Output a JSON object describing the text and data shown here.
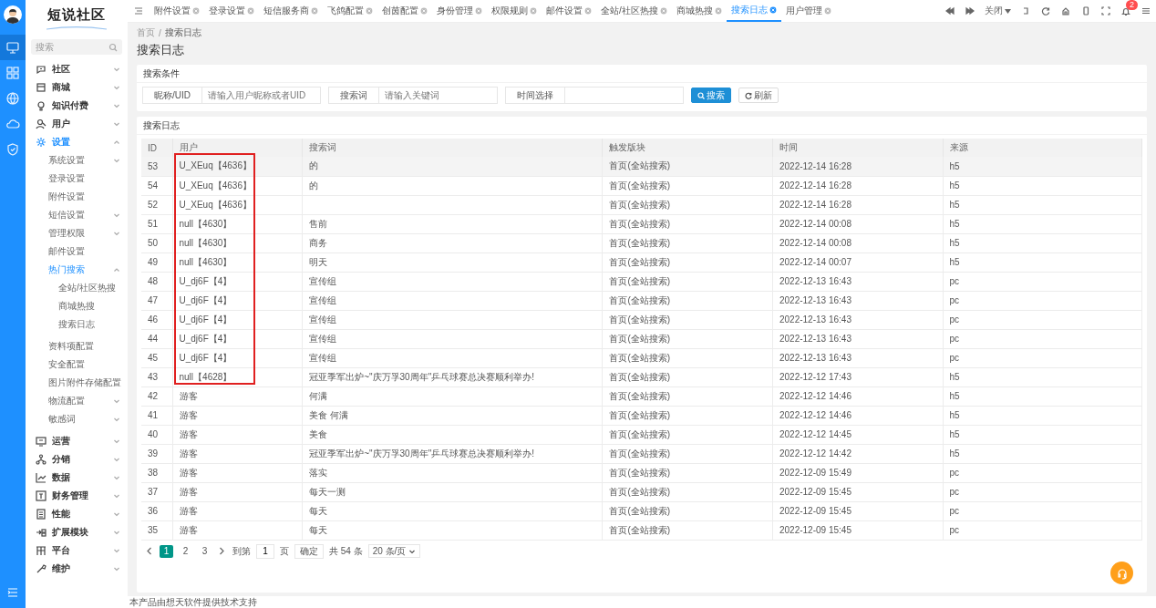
{
  "rail": [
    {
      "selected": true
    },
    {
      "selected": false
    },
    {
      "selected": false
    },
    {
      "selected": false
    },
    {
      "selected": false
    }
  ],
  "brand": {
    "name": "短说社区"
  },
  "sidebar": {
    "search": {
      "placeholder": "搜索"
    },
    "items": [
      {
        "label": "社区",
        "expanded": false
      },
      {
        "label": "商城",
        "expanded": false
      },
      {
        "label": "知识付费",
        "expanded": false
      },
      {
        "label": "用户",
        "expanded": false
      },
      {
        "label": "设置",
        "expanded": true,
        "children": [
          {
            "label": "系统设置",
            "expanded": false
          },
          {
            "label": "登录设置"
          },
          {
            "label": "附件设置"
          },
          {
            "label": "短信设置",
            "expanded": false
          },
          {
            "label": "管理权限",
            "expanded": false
          },
          {
            "label": "邮件设置"
          },
          {
            "label": "热门搜索",
            "expanded": true,
            "children": [
              {
                "label": "全站/社区热搜"
              },
              {
                "label": "商城热搜"
              },
              {
                "label": "搜索日志"
              }
            ]
          },
          {
            "label": "资料项配置"
          },
          {
            "label": "安全配置"
          },
          {
            "label": "图片附件存储配置"
          },
          {
            "label": "物流配置",
            "expanded": false
          },
          {
            "label": "敏感词",
            "expanded": false
          }
        ]
      },
      {
        "label": "运营",
        "expanded": false
      },
      {
        "label": "分销",
        "expanded": false
      },
      {
        "label": "数据",
        "expanded": false
      },
      {
        "label": "财务管理",
        "expanded": false
      },
      {
        "label": "性能",
        "expanded": false
      },
      {
        "label": "扩展模块",
        "expanded": false
      },
      {
        "label": "平台",
        "expanded": false
      },
      {
        "label": "维护",
        "expanded": false
      }
    ]
  },
  "tabs": [
    {
      "label": "附件设置",
      "selected": false
    },
    {
      "label": "登录设置",
      "selected": false
    },
    {
      "label": "短信服务商",
      "selected": false
    },
    {
      "label": "飞鸽配置",
      "selected": false
    },
    {
      "label": "创茵配置",
      "selected": false
    },
    {
      "label": "身份管理",
      "selected": false
    },
    {
      "label": "权限规则",
      "selected": false
    },
    {
      "label": "邮件设置",
      "selected": false
    },
    {
      "label": "全站/社区热搜",
      "selected": false
    },
    {
      "label": "商城热搜",
      "selected": false
    },
    {
      "label": "搜索日志",
      "selected": true
    },
    {
      "label": "用户管理",
      "selected": false
    }
  ],
  "toolbar": {
    "close_menu": "关闭",
    "notification_count": "2"
  },
  "breadcrumb": {
    "items": [
      "首页",
      "搜索日志"
    ],
    "separator": "/"
  },
  "page_title": "搜索日志",
  "filter_panel": {
    "title": "搜索条件",
    "fields": [
      {
        "label": "昵称/UID",
        "placeholder": "请输入用户昵称或者UID"
      },
      {
        "label": "搜索词",
        "placeholder": "请输入关键词"
      },
      {
        "label": "时间选择"
      }
    ],
    "buttons": [
      {
        "label": "搜索",
        "kind": "primary"
      },
      {
        "label": "刷新",
        "kind": "default"
      }
    ]
  },
  "log_panel": {
    "title": "搜索日志",
    "table": {
      "columns": [
        "ID",
        "用户",
        "搜索词",
        "触发版块",
        "时间",
        "来源"
      ],
      "rows": [
        {
          "id": "53",
          "user": "U_XEuq【4636】",
          "keyword": "的",
          "section": "首页(全站搜索)",
          "time": "2022-12-14 16:28",
          "source": "h5",
          "highlighted": true,
          "marked": true
        },
        {
          "id": "54",
          "user": "U_XEuq【4636】",
          "keyword": "的",
          "section": "首页(全站搜索)",
          "time": "2022-12-14 16:28",
          "source": "h5",
          "highlighted": false,
          "marked": true
        },
        {
          "id": "52",
          "user": "U_XEuq【4636】",
          "section": "首页(全站搜索)",
          "time": "2022-12-14 16:28",
          "source": "h5",
          "highlighted": false,
          "marked": true
        },
        {
          "id": "51",
          "user": "null【4630】",
          "keyword": "售前",
          "section": "首页(全站搜索)",
          "time": "2022-12-14 00:08",
          "source": "h5",
          "highlighted": false,
          "marked": true
        },
        {
          "id": "50",
          "user": "null【4630】",
          "keyword": "商务",
          "section": "首页(全站搜索)",
          "time": "2022-12-14 00:08",
          "source": "h5",
          "highlighted": false,
          "marked": true
        },
        {
          "id": "49",
          "user": "null【4630】",
          "keyword": "明天",
          "section": "首页(全站搜索)",
          "time": "2022-12-14 00:07",
          "source": "h5",
          "highlighted": false,
          "marked": true
        },
        {
          "id": "48",
          "user": "U_dj6F【4】",
          "keyword": "宣传组",
          "section": "首页(全站搜索)",
          "time": "2022-12-13 16:43",
          "source": "pc",
          "highlighted": false,
          "marked": true
        },
        {
          "id": "47",
          "user": "U_dj6F【4】",
          "keyword": "宣传组",
          "section": "首页(全站搜索)",
          "time": "2022-12-13 16:43",
          "source": "pc",
          "highlighted": false,
          "marked": true
        },
        {
          "id": "46",
          "user": "U_dj6F【4】",
          "keyword": "宣传组",
          "section": "首页(全站搜索)",
          "time": "2022-12-13 16:43",
          "source": "pc",
          "highlighted": false,
          "marked": true
        },
        {
          "id": "44",
          "user": "U_dj6F【4】",
          "keyword": "宣传组",
          "section": "首页(全站搜索)",
          "time": "2022-12-13 16:43",
          "source": "pc",
          "highlighted": false,
          "marked": true
        },
        {
          "id": "45",
          "user": "U_dj6F【4】",
          "keyword": "宣传组",
          "section": "首页(全站搜索)",
          "time": "2022-12-13 16:43",
          "source": "pc",
          "highlighted": false,
          "marked": true
        },
        {
          "id": "43",
          "user": "null【4628】",
          "keyword": "冠亚季军出炉~\"庆万孚30周年\"乒乓球赛总决赛顺利举办!",
          "section": "首页(全站搜索)",
          "time": "2022-12-12 17:43",
          "source": "h5",
          "highlighted": false,
          "marked": true
        },
        {
          "id": "42",
          "user": "游客",
          "keyword": "何满",
          "section": "首页(全站搜索)",
          "time": "2022-12-12 14:46",
          "source": "h5",
          "highlighted": false,
          "marked": false
        },
        {
          "id": "41",
          "user": "游客",
          "keyword": "美食 何满",
          "section": "首页(全站搜索)",
          "time": "2022-12-12 14:46",
          "source": "h5",
          "highlighted": false,
          "marked": false
        },
        {
          "id": "40",
          "user": "游客",
          "keyword": "美食",
          "section": "首页(全站搜索)",
          "time": "2022-12-12 14:45",
          "source": "h5",
          "highlighted": false,
          "marked": false
        },
        {
          "id": "39",
          "user": "游客",
          "keyword": "冠亚季军出炉~\"庆万孚30周年\"乒乓球赛总决赛顺利举办!",
          "section": "首页(全站搜索)",
          "time": "2022-12-12 14:42",
          "source": "h5",
          "highlighted": false,
          "marked": false
        },
        {
          "id": "38",
          "user": "游客",
          "keyword": "落实",
          "section": "首页(全站搜索)",
          "time": "2022-12-09 15:49",
          "source": "pc",
          "highlighted": false,
          "marked": false
        },
        {
          "id": "37",
          "user": "游客",
          "keyword": "每天一测",
          "section": "首页(全站搜索)",
          "time": "2022-12-09 15:45",
          "source": "pc",
          "highlighted": false,
          "marked": false
        },
        {
          "id": "36",
          "user": "游客",
          "keyword": "每天",
          "section": "首页(全站搜索)",
          "time": "2022-12-09 15:45",
          "source": "pc",
          "highlighted": false,
          "marked": false
        },
        {
          "id": "35",
          "user": "游客",
          "keyword": "每天",
          "section": "首页(全站搜索)",
          "time": "2022-12-09 15:45",
          "source": "pc",
          "highlighted": false,
          "marked": false
        }
      ]
    },
    "pagination": {
      "pages": [
        {
          "label": "1",
          "selected": true
        },
        {
          "label": "2",
          "selected": false
        },
        {
          "label": "3",
          "selected": false
        }
      ],
      "goto_label": "到第",
      "page_input": "1",
      "page_unit": "页",
      "confirm": "确定",
      "total": "共 54 条",
      "page_size": "20 条/页"
    }
  },
  "footer": "本产品由想天软件提供技术支持"
}
